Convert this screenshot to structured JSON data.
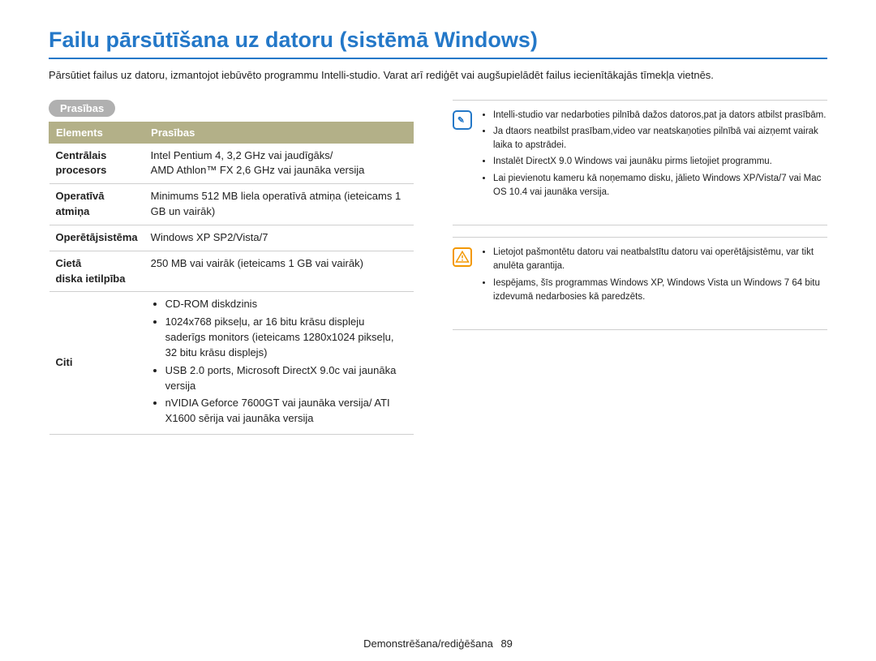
{
  "title": "Failu pārsūtīšana uz datoru (sistēmā Windows)",
  "intro": "Pārsūtiet failus uz datoru, izmantojot iebūvēto programmu Intelli-studio. Varat arī rediģēt vai augšupielādēt failus iecienītākajās tīmekļa vietnēs.",
  "section_label": "Prasības",
  "table": {
    "head_left": "Elements",
    "head_right": "Prasības",
    "rows": [
      {
        "lbl": "Centrālais procesors",
        "val": "Intel Pentium 4, 3,2 GHz vai jaudīgāks/\nAMD Athlon™ FX 2,6 GHz vai jaunāka versija"
      },
      {
        "lbl": "Operatīvā atmiņa",
        "val": "Minimums 512 MB liela operatīvā atmiņa (ieteicams 1 GB un vairāk)"
      },
      {
        "lbl": "Operētājsistēma",
        "val": "Windows XP SP2/Vista/7"
      },
      {
        "lbl": "Cietā diska ietilpība",
        "val": "250 MB vai vairāk (ieteicams 1 GB vai vairāk)"
      }
    ],
    "other_lbl": "Citi",
    "other_items": [
      "CD-ROM diskdzinis",
      "1024x768 pikseļu, ar 16 bitu krāsu displeju saderīgs monitors (ieteicams 1280x1024 pikseļu, 32 bitu krāsu displejs)",
      "USB 2.0 ports, Microsoft DirectX 9.0c vai jaunāka versija",
      "nVIDIA Geforce 7600GT vai jaunāka versija/ ATI X1600 sērija vai jaunāka versija"
    ]
  },
  "info_notes": [
    "Intelli-studio var nedarboties pilnībā dažos datoros,pat ja dators atbilst prasībām.",
    "Ja dtaors neatbilst prasībam,video var neatskaņoties pilnībā vai aizņemt vairak laika to apstrādei.",
    "Instalēt DirectX 9.0 Windows vai jaunāku pirms lietojiet programmu.",
    "Lai pievienotu kameru kā noņemamo disku, jālieto Windows XP/Vista/7 vai Mac OS 10.4 vai jaunāka versija."
  ],
  "warning_notes": [
    "Lietojot pašmontētu datoru vai neatbalstītu datoru vai operētājsistēmu, var tikt anulēta garantija.",
    "Iespējams, šīs programmas Windows XP, Windows Vista un Windows 7 64 bitu izdevumā nedarbosies kā paredzēts."
  ],
  "footer": {
    "section": "Demonstrēšana/rediģēšana",
    "page": "89"
  }
}
